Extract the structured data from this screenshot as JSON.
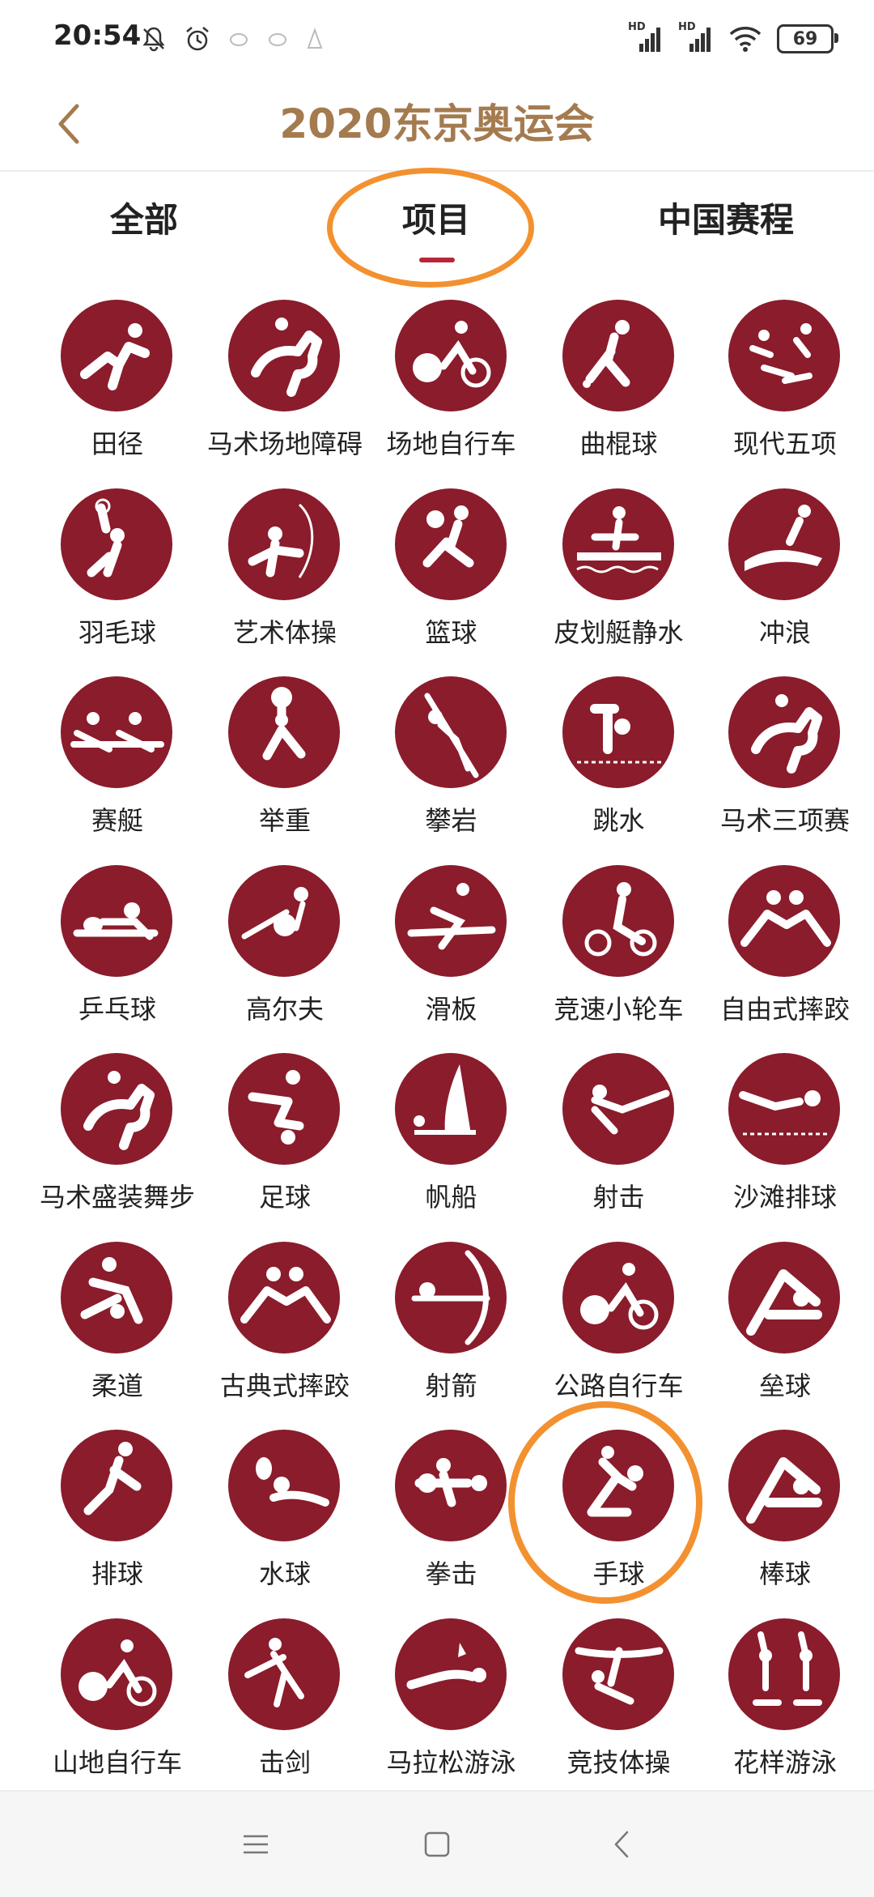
{
  "status_bar": {
    "time": "20:54",
    "left_icons": [
      "bell-off-icon",
      "alarm-icon",
      "notification-icon",
      "notification-icon",
      "notification-icon"
    ],
    "signal1_label": "HD",
    "signal2_label": "HD",
    "battery": "69"
  },
  "header": {
    "title": "2020东京奥运会",
    "back_icon": "chevron-left-icon"
  },
  "tabs": [
    {
      "label": "全部"
    },
    {
      "label": "项目"
    },
    {
      "label": "中国赛程"
    }
  ],
  "active_tab": "项目",
  "accent_colors": {
    "title": "#a47b4f",
    "icon_circle": "#8a1c2b",
    "tab_underline": "#b8263a",
    "highlight": "#f39130"
  },
  "sports": [
    {
      "label": "田径"
    },
    {
      "label": "马术场地障碍"
    },
    {
      "label": "场地自行车"
    },
    {
      "label": "曲棍球"
    },
    {
      "label": "现代五项"
    },
    {
      "label": "羽毛球"
    },
    {
      "label": "艺术体操"
    },
    {
      "label": "篮球"
    },
    {
      "label": "皮划艇静水"
    },
    {
      "label": "冲浪"
    },
    {
      "label": "赛艇"
    },
    {
      "label": "举重"
    },
    {
      "label": "攀岩"
    },
    {
      "label": "跳水"
    },
    {
      "label": "马术三项赛"
    },
    {
      "label": "乒乓球"
    },
    {
      "label": "高尔夫"
    },
    {
      "label": "滑板"
    },
    {
      "label": "竞速小轮车"
    },
    {
      "label": "自由式摔跤"
    },
    {
      "label": "马术盛装舞步"
    },
    {
      "label": "足球"
    },
    {
      "label": "帆船"
    },
    {
      "label": "射击"
    },
    {
      "label": "沙滩排球"
    },
    {
      "label": "柔道"
    },
    {
      "label": "古典式摔跤"
    },
    {
      "label": "射箭"
    },
    {
      "label": "公路自行车"
    },
    {
      "label": "垒球"
    },
    {
      "label": "排球"
    },
    {
      "label": "水球"
    },
    {
      "label": "拳击"
    },
    {
      "label": "手球"
    },
    {
      "label": "棒球"
    },
    {
      "label": "山地自行车"
    },
    {
      "label": "击剑"
    },
    {
      "label": "马拉松游泳"
    },
    {
      "label": "竞技体操"
    },
    {
      "label": "花样游泳"
    }
  ],
  "highlighted_sport": "手球",
  "nav_bar": {
    "icons": [
      "menu-icon",
      "home-icon",
      "back-icon"
    ]
  }
}
